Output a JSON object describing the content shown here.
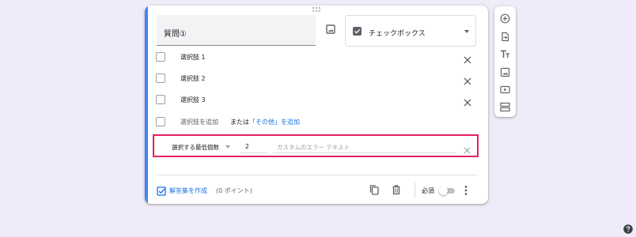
{
  "question": {
    "title": "質問①",
    "type_label": "チェックボックス",
    "image_icon": "image-icon",
    "type_icon": "checkbox-checked-icon"
  },
  "options": [
    {
      "label": "選択肢 1"
    },
    {
      "label": "選択肢 2"
    },
    {
      "label": "選択肢 3"
    }
  ],
  "add_option": {
    "label": "選択肢を追加",
    "or_text": "または",
    "other_link": "「その他」を追加"
  },
  "validation": {
    "rule_label": "選択する最低個数",
    "number_value": "2",
    "error_placeholder": "カスタムのエラー テキスト"
  },
  "footer": {
    "answer_key_label": "解答集を作成",
    "points_label": "(0 ポイント)",
    "required_label": "必須",
    "required_on": false
  },
  "toolbar_icons": [
    "add-question-icon",
    "import-questions-icon",
    "add-title-icon",
    "add-image-icon",
    "add-video-icon",
    "add-section-icon"
  ],
  "colors": {
    "accent": "#4285f4",
    "link": "#1a73e8",
    "highlight": "#e91e63",
    "background": "#f0ebf8"
  }
}
